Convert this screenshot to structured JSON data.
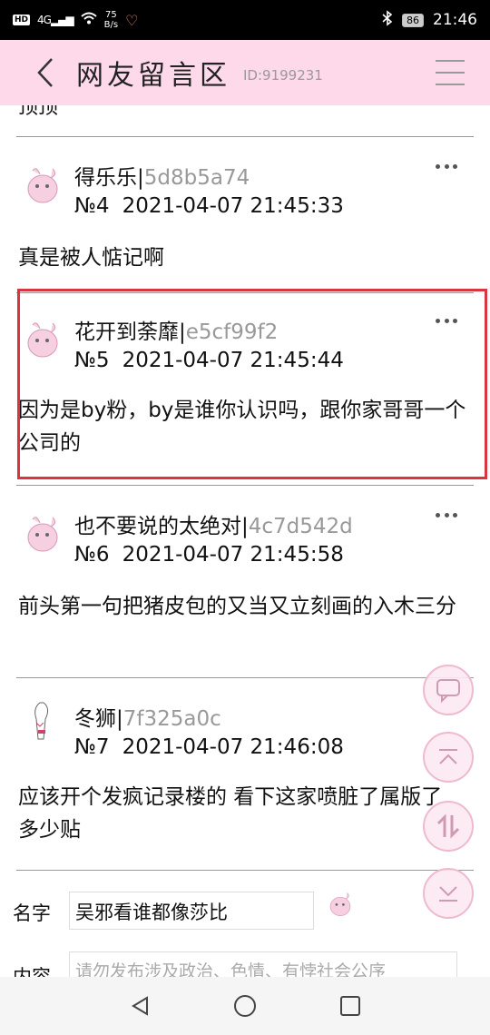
{
  "status_bar": {
    "hd": "HD",
    "signal": "4G",
    "speed_value": "75",
    "speed_unit": "B/s",
    "battery": "86",
    "time": "21:46"
  },
  "header": {
    "title": "网友留言区",
    "id_text": "ID:9199231"
  },
  "cut_text": "顶顶",
  "posts": [
    {
      "name": "得乐乐",
      "hash": "5d8b5a74",
      "no": "№4",
      "datetime": "2021-04-07 21:45:33",
      "body": "真是被人惦记啊"
    },
    {
      "name": "花开到荼靡",
      "hash": "e5cf99f2",
      "no": "№5",
      "datetime": "2021-04-07 21:45:44",
      "body": "因为是by粉，by是谁你认识吗，跟你家哥哥一个公司的"
    },
    {
      "name": "也不要说的太绝对",
      "hash": "4c7d542d",
      "no": "№6",
      "datetime": "2021-04-07 21:45:58",
      "body": "前头第一句把猪皮包的又当又立刻画的入木三分"
    },
    {
      "name": "冬狮",
      "hash": "7f325a0c",
      "no": "№7",
      "datetime": "2021-04-07 21:46:08",
      "body": "应该开个发疯记录楼的 看下这家喷脏了属版了多少贴"
    }
  ],
  "separator": "|",
  "form": {
    "name_label": "名字",
    "name_value": "吴邪看谁都像莎比",
    "content_label": "内容",
    "content_placeholder": "请勿发布涉及政治、色情、有悖社会公序"
  },
  "colors": {
    "header_bg": "#fdd9ea",
    "highlight": "#d9343f",
    "hash_text": "#999999",
    "float_border": "#efb9d0"
  }
}
